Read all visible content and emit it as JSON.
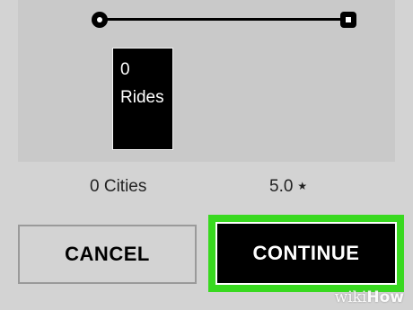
{
  "route": {
    "start_icon": "route-start-dot-icon",
    "end_icon": "route-end-square-icon"
  },
  "rides_box": {
    "text": "0 Rides"
  },
  "stats": {
    "cities_label": "0 Cities",
    "rating_value": "5.0",
    "rating_icon": "★"
  },
  "buttons": {
    "cancel_label": "CANCEL",
    "continue_label": "CONTINUE",
    "highlight_color": "#38d91f"
  },
  "watermark": {
    "wiki": "wiki",
    "how": "How"
  }
}
